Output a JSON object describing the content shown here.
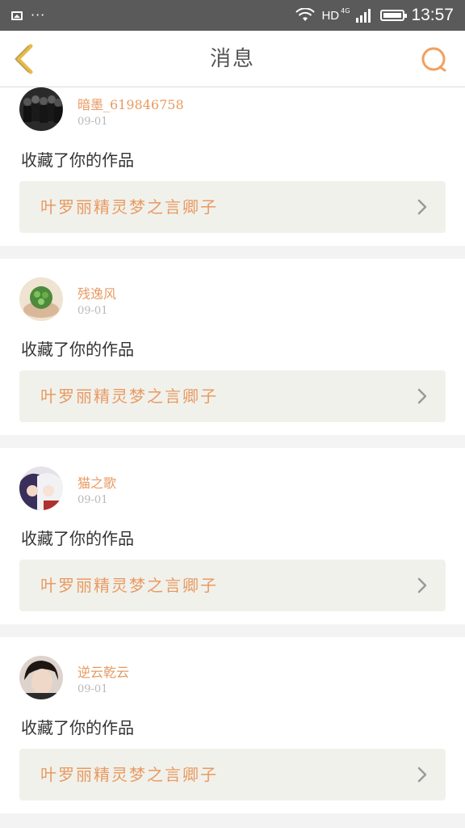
{
  "status_bar": {
    "network": "HD",
    "network_sub": "4G",
    "time": "13:57",
    "dots": "···"
  },
  "nav": {
    "title": "消息"
  },
  "colors": {
    "accent": "#e89a62",
    "back_arrow": "#e8b94a",
    "card_bg": "#f1f1eb"
  },
  "messages": [
    {
      "user": "暗墨_619846758",
      "date": "09-01",
      "action": "收藏了你的作品",
      "work_title": "叶罗丽精灵梦之言卿子",
      "avatar_icon": "avatar-group-photo"
    },
    {
      "user": "残逸风",
      "date": "09-01",
      "action": "收藏了你的作品",
      "work_title": "叶罗丽精灵梦之言卿子",
      "avatar_icon": "avatar-green-plant"
    },
    {
      "user": "猫之歌",
      "date": "09-01",
      "action": "收藏了你的作品",
      "work_title": "叶罗丽精灵梦之言卿子",
      "avatar_icon": "avatar-anime"
    },
    {
      "user": "逆云乾云",
      "date": "09-01",
      "action": "收藏了你的作品",
      "work_title": "叶罗丽精灵梦之言卿子",
      "avatar_icon": "avatar-portrait"
    }
  ]
}
